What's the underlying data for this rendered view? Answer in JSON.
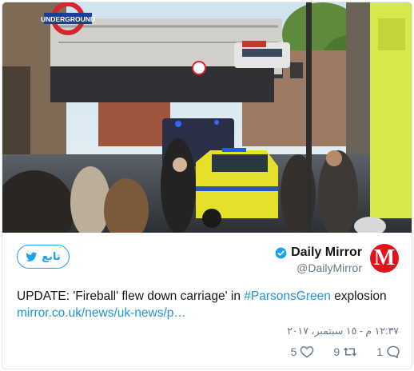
{
  "photo": {
    "station_sign": "UNDERGROUND"
  },
  "follow_button": {
    "label": "تابع",
    "icon": "twitter-bird-icon"
  },
  "author": {
    "name": "Daily Mirror",
    "handle": "@DailyMirror",
    "avatar_letter": "M",
    "verified_icon": "verified-badge-icon"
  },
  "tweet": {
    "text_before": "UPDATE: 'Fireball' flew down carriage' in ",
    "hashtag": "#ParsonsGreen",
    "text_after": " explosion",
    "link": "mirror.co.uk/news/uk-news/p…"
  },
  "timestamp": "١٢:٣٧ م - ١٥ سبتمبر، ٢٠١٧",
  "actions": {
    "like_count": "5",
    "retweet_count": "9",
    "reply_count": "1"
  },
  "colors": {
    "accent": "#1da1f2",
    "link": "#1b95e0",
    "muted": "#657786",
    "brand_red": "#e8111b"
  }
}
